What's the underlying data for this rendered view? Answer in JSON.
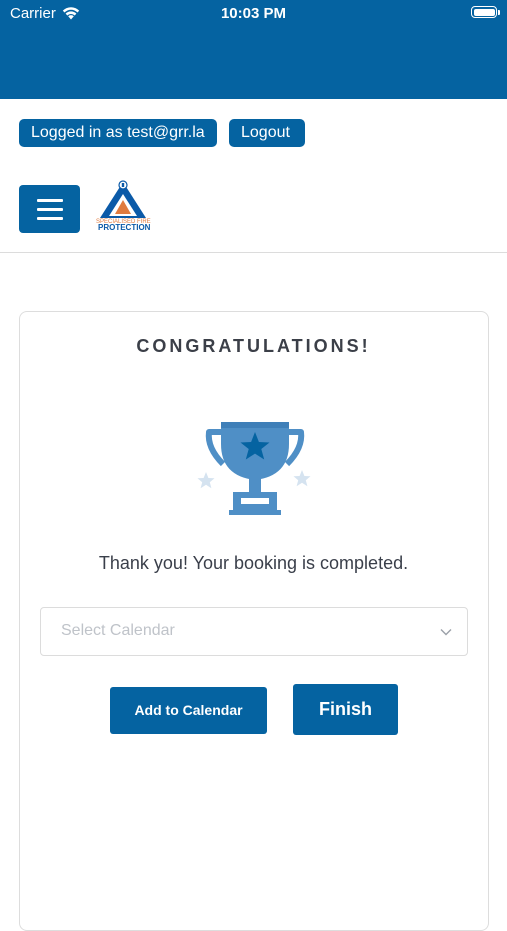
{
  "status_bar": {
    "carrier": "Carrier",
    "time": "10:03 PM"
  },
  "header": {
    "login_label": "Logged in as test@grr.la",
    "logout_label": "Logout",
    "logo": {
      "subtitle": "SPECIALISED FIRE",
      "name": "PROTECTION"
    }
  },
  "card": {
    "title": "CONGRATULATIONS!",
    "message": "Thank you! Your booking is completed.",
    "calendar_select": {
      "placeholder": "Select Calendar"
    },
    "add_to_calendar_label": "Add to Calendar",
    "finish_label": "Finish"
  },
  "colors": {
    "brand_blue": "#0563a1",
    "trophy_blue": "#4f8fc6",
    "star_light": "#d5e3f0"
  },
  "icons": [
    "wifi-icon",
    "battery-icon",
    "menu-icon",
    "trophy-icon",
    "chevron-down-icon"
  ]
}
